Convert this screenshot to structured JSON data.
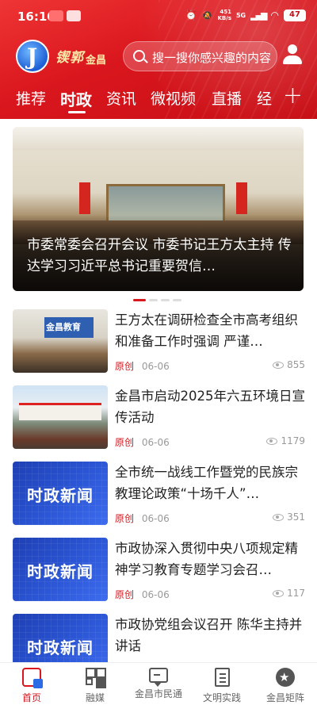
{
  "status_bar": {
    "time": "16:10",
    "net_speed_value": "451",
    "net_speed_unit": "KB/s",
    "network": "5G",
    "battery": "47"
  },
  "brand": {
    "name": "锲郭",
    "city": "金昌"
  },
  "search": {
    "placeholder": "搜一搜你感兴趣的内容"
  },
  "tabs": {
    "items": [
      "推荐",
      "时政",
      "资讯",
      "微视频",
      "直播",
      "经"
    ],
    "active": "时政",
    "add_label": "+"
  },
  "banner": {
    "title": "市委常委会召开会议  市委书记王方太主持    传达学习习近平总书记重要贺信…",
    "page_count": 4,
    "active_page": 1
  },
  "news": [
    {
      "title": "王方太在调研检查全市高考组织和准备工作时强调  严谨…",
      "tag": "原创",
      "date": "06-06",
      "views": "855",
      "thumb_text": "金昌教育"
    },
    {
      "title": "金昌市启动2025年六五环境日宣传活动",
      "tag": "原创",
      "date": "06-06",
      "views": "1179",
      "thumb_text": ""
    },
    {
      "title": "全市统一战线工作暨党的民族宗教理论政策“十场千人”…",
      "tag": "原创",
      "date": "06-06",
      "views": "351",
      "thumb_text": "时政新闻"
    },
    {
      "title": "市政协深入贯彻中央八项规定精神学习教育专题学习会召…",
      "tag": "原创",
      "date": "06-06",
      "views": "117",
      "thumb_text": "时政新闻"
    },
    {
      "title": "市政协党组会议召开  陈华主持并讲话",
      "tag": "",
      "date": "",
      "views": "",
      "thumb_text": "时政新闻"
    }
  ],
  "bottom_nav": {
    "items": [
      {
        "label": "首页",
        "icon": "home-icon"
      },
      {
        "label": "融媒",
        "icon": "grid-icon"
      },
      {
        "label": "金昌市民通",
        "icon": "chat-icon"
      },
      {
        "label": "文明实践",
        "icon": "document-icon"
      },
      {
        "label": "金昌矩阵",
        "icon": "star-icon"
      }
    ],
    "active": "首页"
  },
  "colors": {
    "brand_red": "#d9161d",
    "header_red": "#e0232a",
    "thumb_blue": "#2b56d6"
  }
}
